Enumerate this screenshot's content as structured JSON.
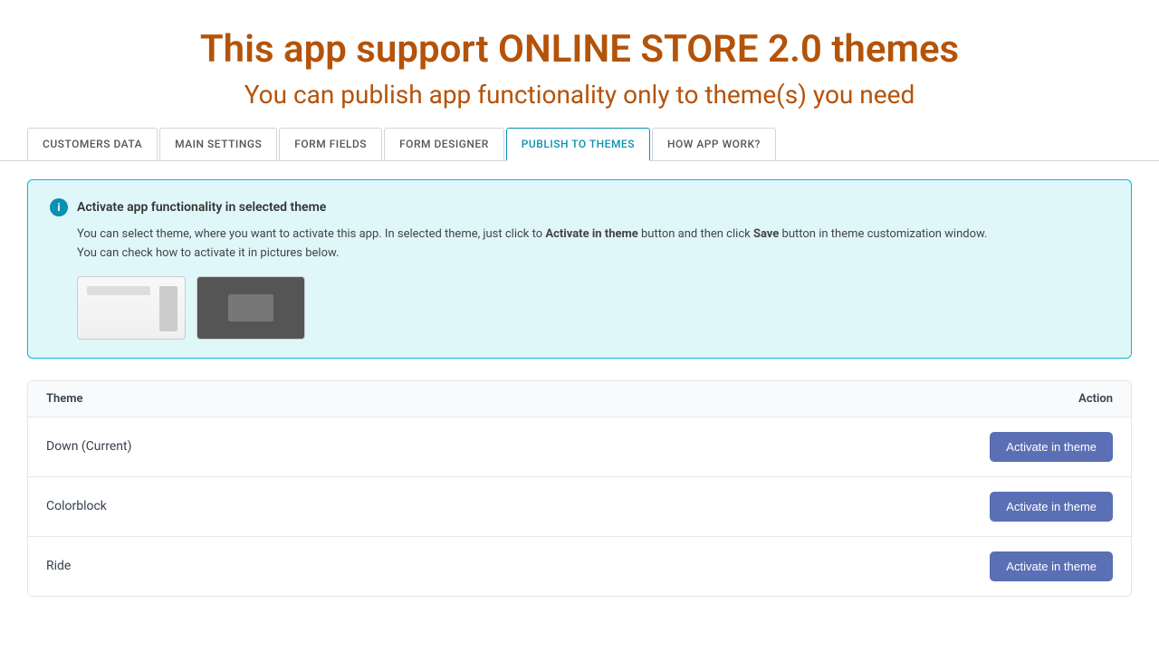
{
  "header": {
    "title": "This app support ONLINE STORE 2.0 themes",
    "subtitle": "You can publish app functionality only to theme(s) you need"
  },
  "tabs": [
    {
      "id": "customers-data",
      "label": "CUSTOMERS DATA",
      "active": false
    },
    {
      "id": "main-settings",
      "label": "MAIN SETTINGS",
      "active": false
    },
    {
      "id": "form-fields",
      "label": "FORM FIELDS",
      "active": false
    },
    {
      "id": "form-designer",
      "label": "FORM DESIGNER",
      "active": false
    },
    {
      "id": "publish-to-themes",
      "label": "PUBLISH TO THEMES",
      "active": true
    },
    {
      "id": "how-app-work",
      "label": "HOW APP WORK?",
      "active": false
    }
  ],
  "infoBox": {
    "title": "Activate app functionality in selected theme",
    "line1_before": "You can select theme, where you want to activate this app. In selected theme, just click to ",
    "line1_bold1": "Activate in theme",
    "line1_middle": " button and then click ",
    "line1_bold2": "Save",
    "line1_after": " button in theme customization window.",
    "line2": "You can check how to activate it in pictures below."
  },
  "table": {
    "header": {
      "theme_col": "Theme",
      "action_col": "Action"
    },
    "rows": [
      {
        "name": "Down (Current)",
        "button_label": "Activate in theme"
      },
      {
        "name": "Colorblock",
        "button_label": "Activate in theme"
      },
      {
        "name": "Ride",
        "button_label": "Activate in theme"
      }
    ]
  }
}
